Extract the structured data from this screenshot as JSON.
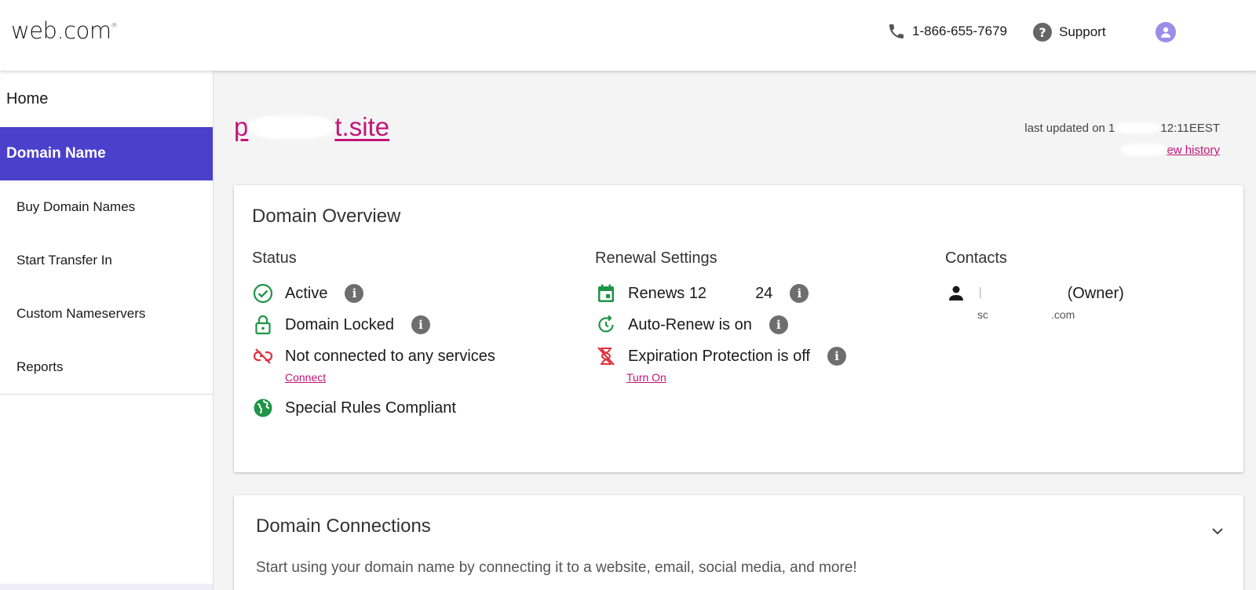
{
  "header": {
    "logo": "web.com",
    "logo_mark": "®",
    "phone": "1-866-655-7679",
    "support": "Support",
    "icons": {
      "phone": "phone-icon",
      "support": "help-circle-icon",
      "avatar": "user-avatar-icon"
    }
  },
  "sidebar": {
    "home": "Home",
    "active": "Domain Name",
    "items": [
      "Buy Domain Names",
      "Start Transfer In",
      "Custom Nameservers",
      "Reports"
    ]
  },
  "domain": {
    "name_start": "p",
    "name_end": "t.site",
    "last_updated_prefix": "last updated on 1",
    "last_updated_time": "12:11EEST",
    "view_history": "ew history"
  },
  "overview": {
    "title": "Domain Overview",
    "status": {
      "title": "Status",
      "active": "Active",
      "locked": "Domain Locked",
      "not_connected": "Not connected to any services",
      "connect": "Connect",
      "special_rules": "Special Rules Compliant"
    },
    "renewal": {
      "title": "Renewal Settings",
      "renews_start": "Renews 12",
      "renews_end": "24",
      "auto_renew": "Auto-Renew is on",
      "expiration": "Expiration Protection is off",
      "turn_on": "Turn On"
    },
    "contacts": {
      "title": "Contacts",
      "owner_start": "I",
      "owner_end": "(Owner)",
      "email_start": "sc",
      "email_end": ".com"
    }
  },
  "connections": {
    "title": "Domain Connections",
    "description": "Start using your domain name by connecting it to a website, email, social media, and more!"
  },
  "colors": {
    "accent": "#4a40cc",
    "link": "#c41478",
    "success": "#1e9447",
    "error": "#e0303a"
  }
}
